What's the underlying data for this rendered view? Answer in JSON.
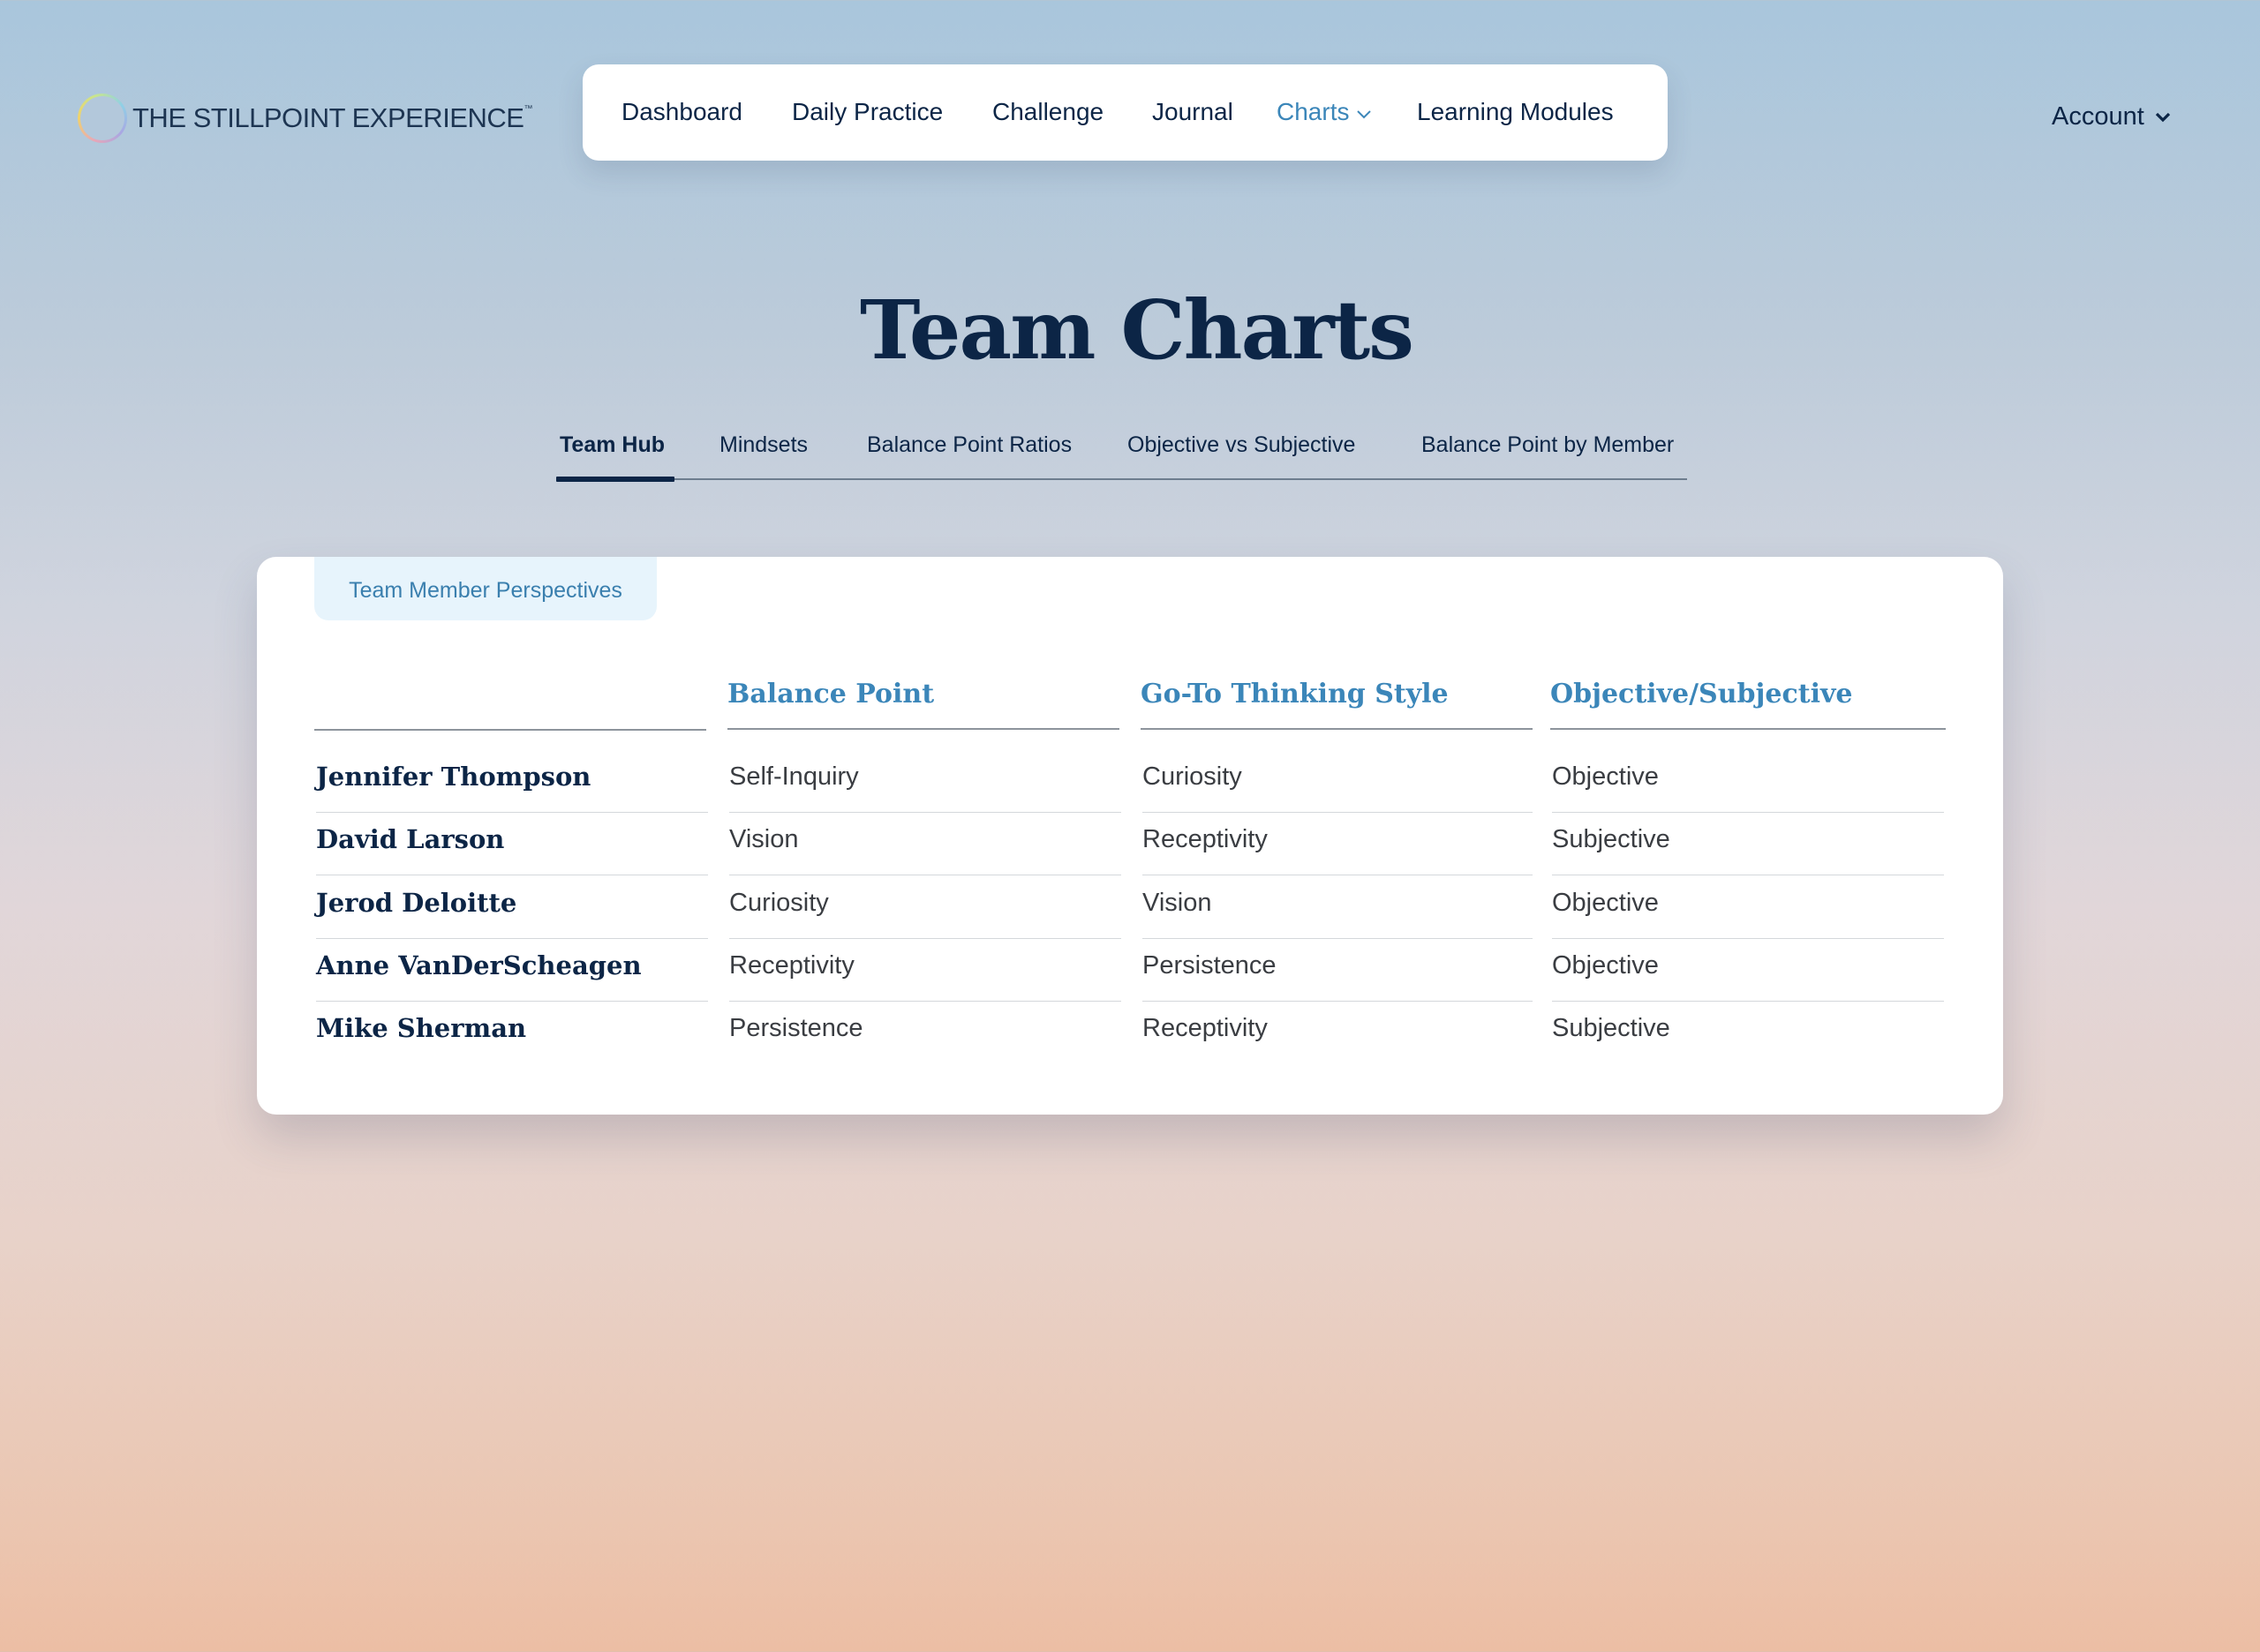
{
  "brand": {
    "name": "THE STILLPOINT EXPERIENCE",
    "trademark": "™"
  },
  "nav": {
    "items": [
      "Dashboard",
      "Daily Practice",
      "Challenge",
      "Journal",
      "Charts",
      "Learning Modules"
    ],
    "active": "Charts",
    "account_label": "Account"
  },
  "page": {
    "title": "Team Charts",
    "tabs": [
      "Team Hub",
      "Mindsets",
      "Balance Point Ratios",
      "Objective vs Subjective",
      "Balance Point by Member"
    ],
    "active_tab": "Team Hub"
  },
  "card": {
    "pill_label": "Team Member Perspectives",
    "table": {
      "columns": [
        "",
        "Balance Point",
        "Go-To Thinking Style",
        "Objective/Subjective"
      ],
      "rows": [
        [
          "Jennifer Thompson",
          "Self-Inquiry",
          "Curiosity",
          "Objective"
        ],
        [
          "David Larson",
          "Vision",
          "Receptivity",
          "Subjective"
        ],
        [
          "Jerod Deloitte",
          "Curiosity",
          "Vision",
          "Objective"
        ],
        [
          "Anne VanDerScheagen",
          "Receptivity",
          "Persistence",
          "Objective"
        ],
        [
          "Mike Sherman",
          "Persistence",
          "Receptivity",
          "Subjective"
        ]
      ]
    }
  },
  "colors": {
    "navy": "#0c2546",
    "accent_blue": "#3b86b9",
    "pill_bg": "#e7f4fc"
  },
  "icons": {
    "logo": "gradient-ring-icon",
    "dropdown": "chevron-down-icon"
  }
}
